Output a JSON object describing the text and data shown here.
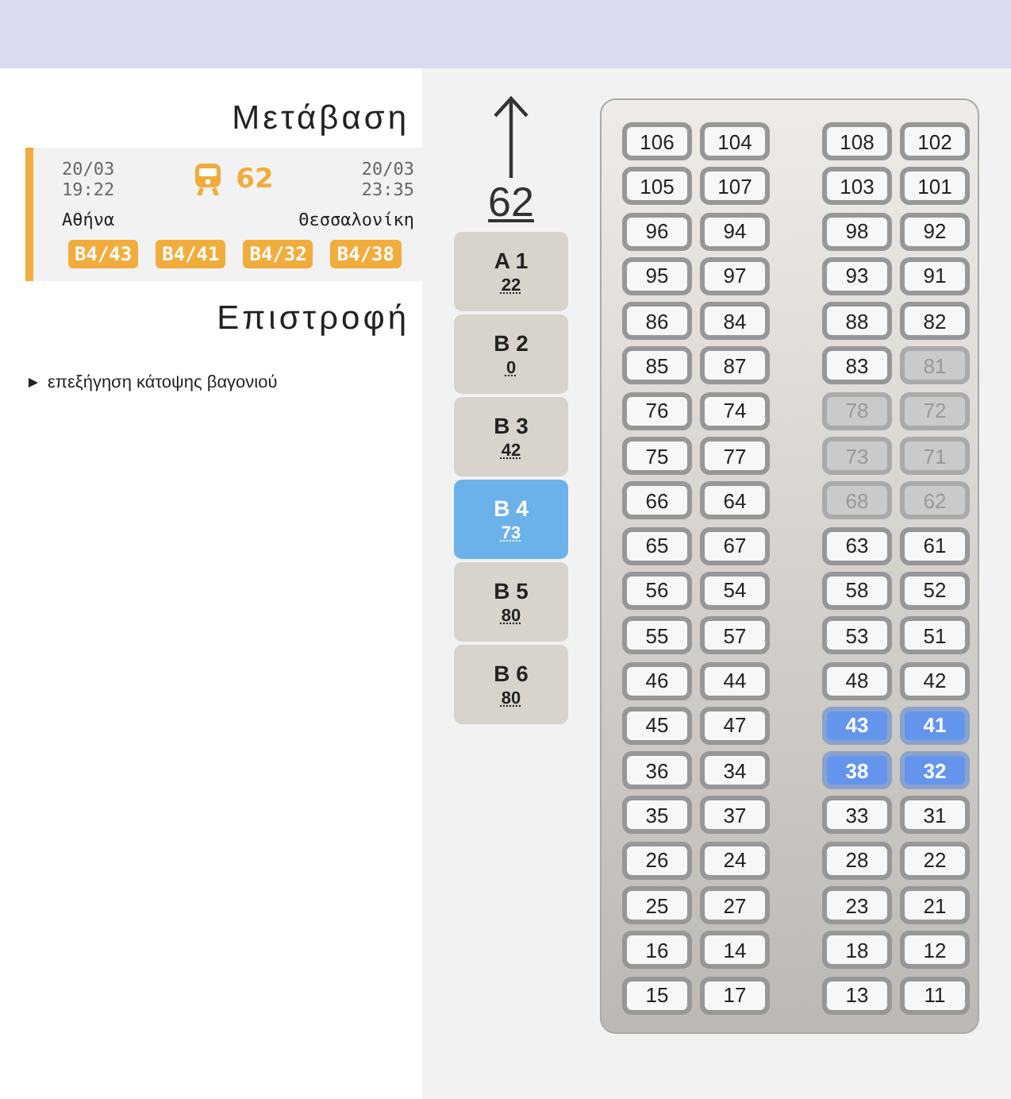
{
  "outbound": {
    "heading": "Μετάβαση",
    "departure_date": "20/03",
    "departure_time": "19:22",
    "train_number": "62",
    "arrival_date": "20/03",
    "arrival_time": "23:35",
    "origin": "Αθήνα",
    "destination": "Θεσσαλονίκη",
    "seats": [
      "B4/43",
      "B4/41",
      "B4/32",
      "B4/38"
    ]
  },
  "return": {
    "heading": "Επιστροφή"
  },
  "details": {
    "label": "επεξήγηση κάτοψης βαγονιού",
    "expanded": false
  },
  "direction": {
    "train_number": "62"
  },
  "coaches": [
    {
      "label": "A 1",
      "free": "22",
      "selected": false
    },
    {
      "label": "B 2",
      "free": "0",
      "selected": false
    },
    {
      "label": "B 3",
      "free": "42",
      "selected": false
    },
    {
      "label": "B 4",
      "free": "73",
      "selected": true
    },
    {
      "label": "B 5",
      "free": "80",
      "selected": false
    },
    {
      "label": "B 6",
      "free": "80",
      "selected": false
    }
  ],
  "seat_rows": [
    [
      {
        "number": "106",
        "disabled": false,
        "selected": false
      },
      {
        "number": "104",
        "disabled": false,
        "selected": false
      },
      {
        "number": "108",
        "disabled": false,
        "selected": false
      },
      {
        "number": "102",
        "disabled": false,
        "selected": false
      }
    ],
    [
      {
        "number": "105",
        "disabled": false,
        "selected": false
      },
      {
        "number": "107",
        "disabled": false,
        "selected": false
      },
      {
        "number": "103",
        "disabled": false,
        "selected": false
      },
      {
        "number": "101",
        "disabled": false,
        "selected": false
      }
    ],
    [
      {
        "number": "96",
        "disabled": false,
        "selected": false
      },
      {
        "number": "94",
        "disabled": false,
        "selected": false
      },
      {
        "number": "98",
        "disabled": false,
        "selected": false
      },
      {
        "number": "92",
        "disabled": false,
        "selected": false
      }
    ],
    [
      {
        "number": "95",
        "disabled": false,
        "selected": false
      },
      {
        "number": "97",
        "disabled": false,
        "selected": false
      },
      {
        "number": "93",
        "disabled": false,
        "selected": false
      },
      {
        "number": "91",
        "disabled": false,
        "selected": false
      }
    ],
    [
      {
        "number": "86",
        "disabled": false,
        "selected": false
      },
      {
        "number": "84",
        "disabled": false,
        "selected": false
      },
      {
        "number": "88",
        "disabled": false,
        "selected": false
      },
      {
        "number": "82",
        "disabled": false,
        "selected": false
      }
    ],
    [
      {
        "number": "85",
        "disabled": false,
        "selected": false
      },
      {
        "number": "87",
        "disabled": false,
        "selected": false
      },
      {
        "number": "83",
        "disabled": false,
        "selected": false
      },
      {
        "number": "81",
        "disabled": true,
        "selected": false
      }
    ],
    [
      {
        "number": "76",
        "disabled": false,
        "selected": false
      },
      {
        "number": "74",
        "disabled": false,
        "selected": false
      },
      {
        "number": "78",
        "disabled": true,
        "selected": false
      },
      {
        "number": "72",
        "disabled": true,
        "selected": false
      }
    ],
    [
      {
        "number": "75",
        "disabled": false,
        "selected": false
      },
      {
        "number": "77",
        "disabled": false,
        "selected": false
      },
      {
        "number": "73",
        "disabled": true,
        "selected": false
      },
      {
        "number": "71",
        "disabled": true,
        "selected": false
      }
    ],
    [
      {
        "number": "66",
        "disabled": false,
        "selected": false
      },
      {
        "number": "64",
        "disabled": false,
        "selected": false
      },
      {
        "number": "68",
        "disabled": true,
        "selected": false
      },
      {
        "number": "62",
        "disabled": true,
        "selected": false
      }
    ],
    [
      {
        "number": "65",
        "disabled": false,
        "selected": false
      },
      {
        "number": "67",
        "disabled": false,
        "selected": false
      },
      {
        "number": "63",
        "disabled": false,
        "selected": false
      },
      {
        "number": "61",
        "disabled": false,
        "selected": false
      }
    ],
    [
      {
        "number": "56",
        "disabled": false,
        "selected": false
      },
      {
        "number": "54",
        "disabled": false,
        "selected": false
      },
      {
        "number": "58",
        "disabled": false,
        "selected": false
      },
      {
        "number": "52",
        "disabled": false,
        "selected": false
      }
    ],
    [
      {
        "number": "55",
        "disabled": false,
        "selected": false
      },
      {
        "number": "57",
        "disabled": false,
        "selected": false
      },
      {
        "number": "53",
        "disabled": false,
        "selected": false
      },
      {
        "number": "51",
        "disabled": false,
        "selected": false
      }
    ],
    [
      {
        "number": "46",
        "disabled": false,
        "selected": false
      },
      {
        "number": "44",
        "disabled": false,
        "selected": false
      },
      {
        "number": "48",
        "disabled": false,
        "selected": false
      },
      {
        "number": "42",
        "disabled": false,
        "selected": false
      }
    ],
    [
      {
        "number": "45",
        "disabled": false,
        "selected": false
      },
      {
        "number": "47",
        "disabled": false,
        "selected": false
      },
      {
        "number": "43",
        "disabled": false,
        "selected": true
      },
      {
        "number": "41",
        "disabled": false,
        "selected": true
      }
    ],
    [
      {
        "number": "36",
        "disabled": false,
        "selected": false
      },
      {
        "number": "34",
        "disabled": false,
        "selected": false
      },
      {
        "number": "38",
        "disabled": false,
        "selected": true
      },
      {
        "number": "32",
        "disabled": false,
        "selected": true
      }
    ],
    [
      {
        "number": "35",
        "disabled": false,
        "selected": false
      },
      {
        "number": "37",
        "disabled": false,
        "selected": false
      },
      {
        "number": "33",
        "disabled": false,
        "selected": false
      },
      {
        "number": "31",
        "disabled": false,
        "selected": false
      }
    ],
    [
      {
        "number": "26",
        "disabled": false,
        "selected": false
      },
      {
        "number": "24",
        "disabled": false,
        "selected": false
      },
      {
        "number": "28",
        "disabled": false,
        "selected": false
      },
      {
        "number": "22",
        "disabled": false,
        "selected": false
      }
    ],
    [
      {
        "number": "25",
        "disabled": false,
        "selected": false
      },
      {
        "number": "27",
        "disabled": false,
        "selected": false
      },
      {
        "number": "23",
        "disabled": false,
        "selected": false
      },
      {
        "number": "21",
        "disabled": false,
        "selected": false
      }
    ],
    [
      {
        "number": "16",
        "disabled": false,
        "selected": false
      },
      {
        "number": "14",
        "disabled": false,
        "selected": false
      },
      {
        "number": "18",
        "disabled": false,
        "selected": false
      },
      {
        "number": "12",
        "disabled": false,
        "selected": false
      }
    ],
    [
      {
        "number": "15",
        "disabled": false,
        "selected": false
      },
      {
        "number": "17",
        "disabled": false,
        "selected": false
      },
      {
        "number": "13",
        "disabled": false,
        "selected": false
      },
      {
        "number": "11",
        "disabled": false,
        "selected": false
      }
    ]
  ]
}
